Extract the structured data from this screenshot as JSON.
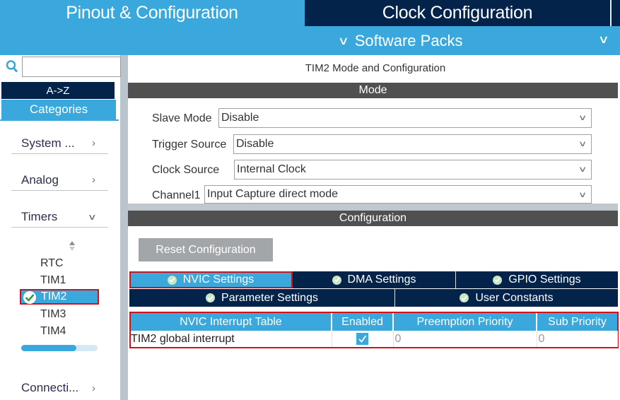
{
  "header": {
    "tabs": [
      {
        "label": "Pinout & Configuration",
        "active": true
      },
      {
        "label": "Clock Configuration",
        "active": false
      }
    ],
    "software_packs_label": "Software Packs"
  },
  "sidebar": {
    "search": {
      "placeholder": "",
      "value": ""
    },
    "sort_az_label": "A->Z",
    "categories_label": "Categories",
    "categories": [
      {
        "label": "System ...",
        "expanded": false
      },
      {
        "label": "Analog",
        "expanded": false
      },
      {
        "label": "Timers",
        "expanded": true
      },
      {
        "label": "Connecti...",
        "expanded": false
      }
    ],
    "timers": [
      {
        "label": "RTC",
        "selected": false
      },
      {
        "label": "TIM1",
        "selected": false
      },
      {
        "label": "TIM2",
        "selected": true,
        "status": "configured"
      },
      {
        "label": "TIM3",
        "selected": false
      },
      {
        "label": "TIM4",
        "selected": false
      }
    ],
    "scroll_fraction": 0.72
  },
  "main": {
    "title": "TIM2 Mode and Configuration",
    "mode_section_label": "Mode",
    "fields": [
      {
        "label": "Slave Mode",
        "value": "Disable"
      },
      {
        "label": "Trigger Source",
        "value": "Disable"
      },
      {
        "label": "Clock Source",
        "value": "Internal Clock"
      },
      {
        "label": "Channel1",
        "value": "Input Capture direct mode"
      }
    ],
    "configuration_section_label": "Configuration",
    "reset_button_label": "Reset Configuration",
    "config_tabs_row1": [
      {
        "label": "NVIC Settings",
        "active": true
      },
      {
        "label": "DMA Settings",
        "active": false
      },
      {
        "label": "GPIO Settings",
        "active": false
      }
    ],
    "config_tabs_row2": [
      {
        "label": "Parameter Settings",
        "active": false
      },
      {
        "label": "User Constants",
        "active": false
      }
    ],
    "nvic_table": {
      "columns": [
        "NVIC Interrupt Table",
        "Enabled",
        "Preemption Priority",
        "Sub Priority"
      ],
      "rows": [
        {
          "name": "TIM2 global interrupt",
          "enabled": true,
          "preemption_priority": "0",
          "sub_priority": "0"
        }
      ]
    }
  },
  "colors": {
    "accent": "#3aa8dc",
    "navy": "#03234b",
    "section_bar": "#505050",
    "highlight_outline": "#d0121b"
  }
}
